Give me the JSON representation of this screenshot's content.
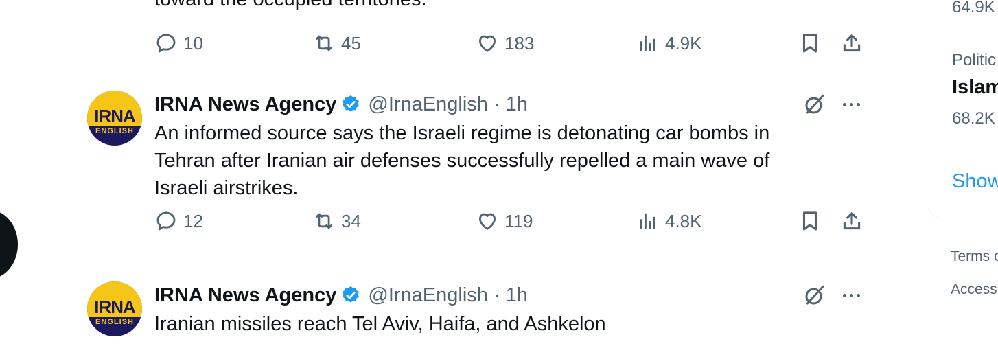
{
  "previous_tweet": {
    "text_tail": "toward the occupied territories.",
    "stats": {
      "replies": "10",
      "reposts": "45",
      "likes": "183",
      "views": "4.9K"
    }
  },
  "tweets": [
    {
      "avatar_text": "IRNA",
      "avatar_subtext": "ENGLISH",
      "name": "IRNA News Agency",
      "handle": "@IrnaEnglish",
      "separator": "·",
      "time": "1h",
      "text": "An informed source says the Israeli regime is detonating car bombs in Tehran after Iranian air defenses successfully repelled a main wave of Israeli airstrikes.",
      "stats": {
        "replies": "12",
        "reposts": "34",
        "likes": "119",
        "views": "4.8K"
      }
    },
    {
      "avatar_text": "IRNA",
      "avatar_subtext": "ENGLISH",
      "name": "IRNA News Agency",
      "handle": "@IrnaEnglish",
      "separator": "·",
      "time": "1h",
      "text": "Iranian missiles reach Tel Aviv, Haifa, and Ashkelon"
    }
  ],
  "trends": {
    "first_count": "64.9K",
    "second_category": "Politic",
    "second_topic": "Islam",
    "second_count": "68.2K",
    "show_more": "Show"
  },
  "footer": {
    "terms": "Terms c",
    "accessibility": "Access"
  },
  "colors": {
    "accent": "#1d9bf0",
    "muted": "#536471",
    "text": "#0f1419",
    "border": "#eff3f4",
    "irna_yellow": "#f5c518",
    "irna_navy": "#1c1a5e"
  },
  "icons": [
    "reply-icon",
    "repost-icon",
    "like-icon",
    "views-icon",
    "bookmark-icon",
    "share-icon",
    "verified-badge-icon",
    "grok-icon",
    "more-icon"
  ]
}
